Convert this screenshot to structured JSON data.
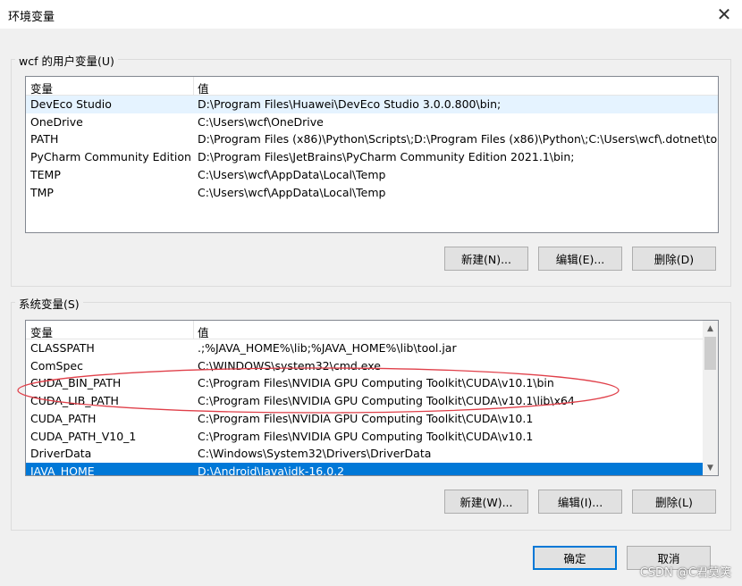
{
  "window": {
    "title": "环境变量"
  },
  "user_vars": {
    "group_label": "wcf 的用户变量(U)",
    "col_name": "变量",
    "col_value": "值",
    "rows": [
      {
        "name": "DevEco Studio",
        "value": "D:\\Program Files\\Huawei\\DevEco Studio 3.0.0.800\\bin;"
      },
      {
        "name": "OneDrive",
        "value": "C:\\Users\\wcf\\OneDrive"
      },
      {
        "name": "PATH",
        "value": "D:\\Program Files (x86)\\Python\\Scripts\\;D:\\Program Files (x86)\\Python\\;C:\\Users\\wcf\\.dotnet\\to..."
      },
      {
        "name": "PyCharm Community Edition",
        "value": "D:\\Program Files\\JetBrains\\PyCharm Community Edition 2021.1\\bin;"
      },
      {
        "name": "TEMP",
        "value": "C:\\Users\\wcf\\AppData\\Local\\Temp"
      },
      {
        "name": "TMP",
        "value": "C:\\Users\\wcf\\AppData\\Local\\Temp"
      }
    ],
    "buttons": {
      "new": "新建(N)...",
      "edit": "编辑(E)...",
      "delete": "删除(D)"
    }
  },
  "system_vars": {
    "group_label": "系统变量(S)",
    "col_name": "变量",
    "col_value": "值",
    "rows": [
      {
        "name": "CLASSPATH",
        "value": ".;%JAVA_HOME%\\lib;%JAVA_HOME%\\lib\\tool.jar"
      },
      {
        "name": "ComSpec",
        "value": "C:\\WINDOWS\\system32\\cmd.exe"
      },
      {
        "name": "CUDA_BIN_PATH",
        "value": "C:\\Program Files\\NVIDIA GPU Computing Toolkit\\CUDA\\v10.1\\bin"
      },
      {
        "name": "CUDA_LIB_PATH",
        "value": "C:\\Program Files\\NVIDIA GPU Computing Toolkit\\CUDA\\v10.1\\lib\\x64"
      },
      {
        "name": "CUDA_PATH",
        "value": "C:\\Program Files\\NVIDIA GPU Computing Toolkit\\CUDA\\v10.1"
      },
      {
        "name": "CUDA_PATH_V10_1",
        "value": "C:\\Program Files\\NVIDIA GPU Computing Toolkit\\CUDA\\v10.1"
      },
      {
        "name": "DriverData",
        "value": "C:\\Windows\\System32\\Drivers\\DriverData"
      },
      {
        "name": "JAVA_HOME",
        "value": "D:\\Android\\Java\\jdk-16.0.2"
      }
    ],
    "buttons": {
      "new": "新建(W)...",
      "edit": "编辑(I)...",
      "delete": "删除(L)"
    }
  },
  "footer": {
    "ok": "确定",
    "cancel": "取消"
  },
  "watermark": "CSDN @C君莫笑",
  "colors": {
    "selection": "#0078d7",
    "annotation": "#e0404a",
    "primary_border": "#0078d7"
  }
}
